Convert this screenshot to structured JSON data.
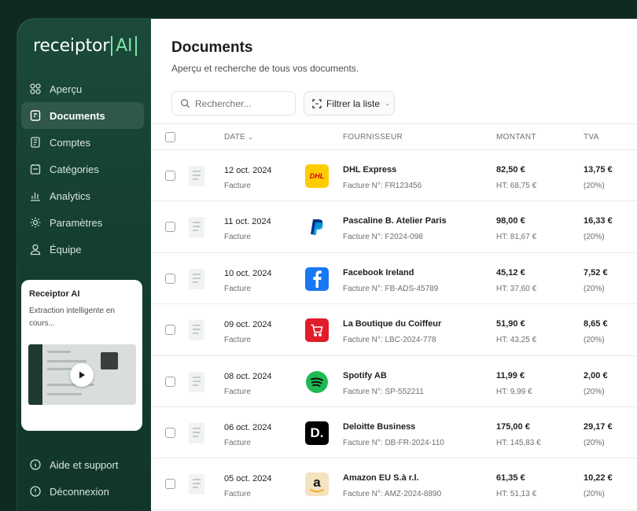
{
  "brand": {
    "name": "receiptor",
    "ai": "AI"
  },
  "nav": [
    {
      "label": "Aperçu",
      "icon": "grid-icon"
    },
    {
      "label": "Documents",
      "icon": "document-icon",
      "active": true
    },
    {
      "label": "Comptes",
      "icon": "receipt-icon"
    },
    {
      "label": "Catégories",
      "icon": "folder-icon"
    },
    {
      "label": "Analytics",
      "icon": "chart-icon"
    },
    {
      "label": "Paramètres",
      "icon": "gear-icon"
    },
    {
      "label": "Équipe",
      "icon": "user-icon"
    }
  ],
  "promo": {
    "title": "Receiptor AI",
    "description": "Extraction intelligente en cours..."
  },
  "bottom_nav": [
    {
      "label": "Aide et support",
      "icon": "info-icon"
    },
    {
      "label": "Déconnexion",
      "icon": "logout-icon"
    }
  ],
  "page": {
    "title": "Documents",
    "subtitle": "Aperçu et recherche de tous vos documents."
  },
  "search": {
    "placeholder": "Rechercher..."
  },
  "filter": {
    "label": "Filtrer la liste"
  },
  "table": {
    "headers": {
      "date": "DATE",
      "vendor": "FOURNISSEUR",
      "amount": "MONTANT",
      "vat": "TVA"
    },
    "rows": [
      {
        "date": "12 oct. 2024",
        "type": "Facture",
        "vendor": "DHL Express",
        "ref": "Facture N°: FR123456",
        "amount": "82,50 €",
        "ht": "HT: 68,75 €",
        "vat": "13,75 €",
        "rate": "(20%)",
        "logo": "dhl",
        "logo_text": "DHL"
      },
      {
        "date": "11 oct. 2024",
        "type": "Facture",
        "vendor": "Pascaline B. Atelier Paris",
        "ref": "Facture N°: F2024-098",
        "amount": "98,00 €",
        "ht": "HT: 81,67 €",
        "vat": "16,33 €",
        "rate": "(20%)",
        "logo": "paypal",
        "logo_text": ""
      },
      {
        "date": "10 oct. 2024",
        "type": "Facture",
        "vendor": "Facebook Ireland",
        "ref": "Facture N°: FB-ADS-45789",
        "amount": "45,12 €",
        "ht": "HT: 37,60 €",
        "vat": "7,52 €",
        "rate": "(20%)",
        "logo": "facebook",
        "logo_text": ""
      },
      {
        "date": "09 oct. 2024",
        "type": "Facture",
        "vendor": "La Boutique du Coiffeur",
        "ref": "Facture N°: LBC-2024-778",
        "amount": "51,90 €",
        "ht": "HT: 43,25 €",
        "vat": "8,65 €",
        "rate": "(20%)",
        "logo": "cart",
        "logo_text": ""
      },
      {
        "date": "08 oct. 2024",
        "type": "Facture",
        "vendor": "Spotify AB",
        "ref": "Facture N°: SP-552211",
        "amount": "11,99 €",
        "ht": "HT: 9,99 €",
        "vat": "2,00 €",
        "rate": "(20%)",
        "logo": "spotify",
        "logo_text": ""
      },
      {
        "date": "06 oct. 2024",
        "type": "Facture",
        "vendor": "Deloitte Business",
        "ref": "Facture N°: DB-FR-2024-110",
        "amount": "175,00 €",
        "ht": "HT: 145,83 €",
        "vat": "29,17 €",
        "rate": "(20%)",
        "logo": "deloitte",
        "logo_text": "D."
      },
      {
        "date": "05 oct. 2024",
        "type": "Facture",
        "vendor": "Amazon EU S.à r.l.",
        "ref": "Facture N°: AMZ-2024-8890",
        "amount": "61,35 €",
        "ht": "HT: 51,13 €",
        "vat": "10,22 €",
        "rate": "(20%)",
        "logo": "amazon",
        "logo_text": "a"
      }
    ]
  },
  "colors": {
    "sidebar": "#1b4a3b",
    "accent": "#7fe6a6",
    "dhl": "#ffcc00",
    "paypal": "#003087",
    "facebook": "#1877f2",
    "cart": "#e11d2b",
    "spotify": "#1db954",
    "deloitte": "#000000",
    "amazon": "#f3e3c0"
  }
}
